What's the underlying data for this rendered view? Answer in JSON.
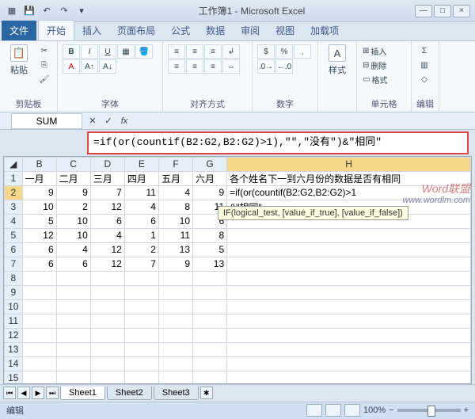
{
  "title": "工作簿1 - Microsoft Excel",
  "tabs": {
    "file": "文件",
    "home": "开始",
    "insert": "插入",
    "layout": "页面布局",
    "formulas": "公式",
    "data": "数据",
    "review": "审阅",
    "view": "视图",
    "addins": "加载项"
  },
  "ribbon": {
    "clipboard": {
      "paste": "粘贴",
      "label": "剪贴板"
    },
    "font": {
      "label": "字体"
    },
    "align": {
      "label": "对齐方式"
    },
    "number": {
      "label": "数字"
    },
    "styles": {
      "btn": "样式",
      "label": ""
    },
    "cells": {
      "insert": "插入",
      "delete": "删除",
      "format": "格式",
      "label": "单元格"
    },
    "editing": {
      "label": "编辑"
    }
  },
  "namebox": "SUM",
  "formula": "=if(or(countif(B2:G2,B2:G2)>1),\"\",\"没有\")&\"相同\"",
  "tooltip": "IF(logical_test, [value_if_true], [value_if_false])",
  "headers": {
    "B": "一月",
    "C": "二月",
    "D": "三月",
    "E": "四月",
    "F": "五月",
    "G": "六月",
    "H": "各个姓名下一到六月份的数据是否有相同"
  },
  "rows": [
    {
      "r": 2,
      "B": 9,
      "C": 9,
      "D": 7,
      "E": 11,
      "F": 4,
      "G": 9,
      "H": "=if(or(countif(B2:G2,B2:G2)>1"
    },
    {
      "r": 3,
      "B": 10,
      "C": 2,
      "D": 12,
      "E": 4,
      "F": 8,
      "G": 11,
      "H": "&\"相同\""
    },
    {
      "r": 4,
      "B": 5,
      "C": 10,
      "D": 6,
      "E": 6,
      "F": 10,
      "G": 6,
      "H": ""
    },
    {
      "r": 5,
      "B": 12,
      "C": 10,
      "D": 4,
      "E": 1,
      "F": 11,
      "G": 8,
      "H": ""
    },
    {
      "r": 6,
      "B": 6,
      "C": 4,
      "D": 12,
      "E": 2,
      "F": 13,
      "G": 5,
      "H": ""
    },
    {
      "r": 7,
      "B": 6,
      "C": 6,
      "D": 12,
      "E": 7,
      "F": 9,
      "G": 13,
      "H": ""
    }
  ],
  "sheets": [
    "Sheet1",
    "Sheet2",
    "Sheet3"
  ],
  "status": "编辑",
  "zoom": "100%",
  "watermark": {
    "main": "Word联盟",
    "sub": "www.wordlm.com"
  },
  "chart_data": {
    "type": "table",
    "title": "各个姓名下一到六月份的数据是否有相同",
    "categories": [
      "一月",
      "二月",
      "三月",
      "四月",
      "五月",
      "六月"
    ],
    "series": [
      {
        "name": "Row2",
        "values": [
          9,
          9,
          7,
          11,
          4,
          9
        ]
      },
      {
        "name": "Row3",
        "values": [
          10,
          2,
          12,
          4,
          8,
          11
        ]
      },
      {
        "name": "Row4",
        "values": [
          5,
          10,
          6,
          6,
          10,
          6
        ]
      },
      {
        "name": "Row5",
        "values": [
          12,
          10,
          4,
          1,
          11,
          8
        ]
      },
      {
        "name": "Row6",
        "values": [
          6,
          4,
          12,
          2,
          13,
          5
        ]
      },
      {
        "name": "Row7",
        "values": [
          6,
          6,
          12,
          7,
          9,
          13
        ]
      }
    ]
  }
}
